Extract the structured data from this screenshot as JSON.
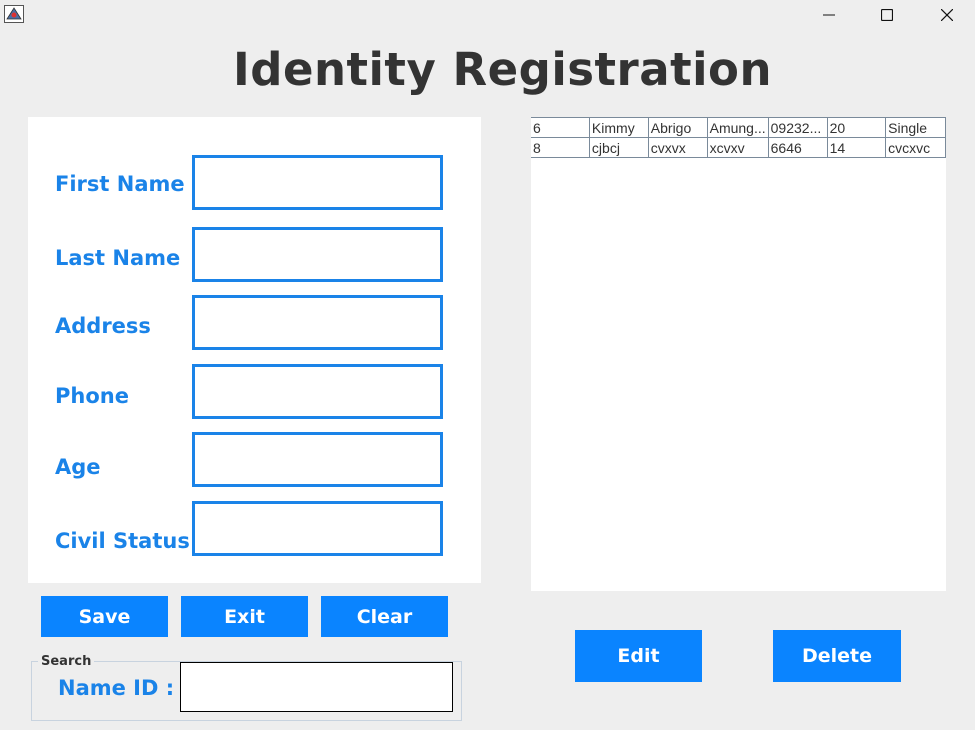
{
  "window": {
    "minimize_label": "—",
    "maximize_label": "☐",
    "close_label": "✕",
    "icon": "java-app-icon"
  },
  "page": {
    "title": "Identity Registration"
  },
  "form": {
    "fields": [
      {
        "label": "First Name",
        "value": ""
      },
      {
        "label": "Last Name",
        "value": ""
      },
      {
        "label": "Address",
        "value": ""
      },
      {
        "label": "Phone",
        "value": ""
      },
      {
        "label": "Age",
        "value": ""
      },
      {
        "label": "Civil Status",
        "value": ""
      }
    ]
  },
  "buttons": {
    "save": "Save",
    "exit": "Exit",
    "clear": "Clear",
    "edit": "Edit",
    "delete": "Delete"
  },
  "search": {
    "legend": "Search",
    "label": "Name ID :",
    "value": ""
  },
  "table": {
    "rows": [
      [
        "6",
        "Kimmy",
        "Abrigo",
        "Amung...",
        "09232...",
        "20",
        "Single"
      ],
      [
        "8",
        "cjbcj",
        "cvxvx",
        "xcvxv",
        "6646",
        "14",
        "cvcxvc"
      ]
    ]
  },
  "colors": {
    "accent": "#1a83e8",
    "button": "#0a84ff",
    "background": "#eeeeee",
    "panel": "#ffffff",
    "title": "#333333"
  }
}
